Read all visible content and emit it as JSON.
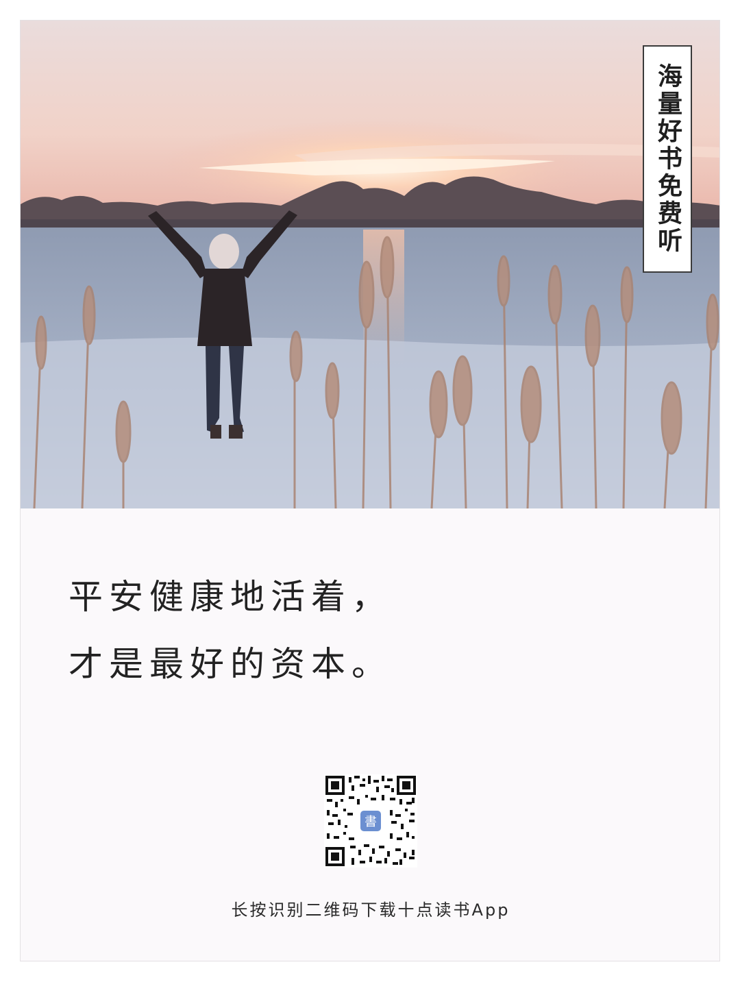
{
  "badge": {
    "text": "海量好书免费听"
  },
  "quote": {
    "line1": "平安健康地活着，",
    "line2": "才是最好的资本。"
  },
  "qr": {
    "center_glyph": "書"
  },
  "caption": {
    "text": "长按识别二维码下载十点读书App"
  },
  "colors": {
    "sky_top": "#efe2e0",
    "sky_glow": "#f4c6b6",
    "sun": "#fff0dc",
    "water": "#9aa7bb",
    "ice": "#c5cddd",
    "reeds": "#b28a78",
    "qr_icon": "#6b8fd1"
  }
}
